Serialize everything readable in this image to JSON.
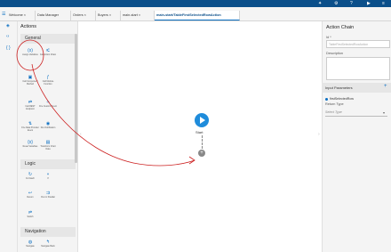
{
  "topbar": {
    "icons": [
      "settings-icon",
      "gear-icon",
      "help-icon",
      "run-icon",
      "menu-icon"
    ]
  },
  "tabs": [
    {
      "label": "Welcome ×"
    },
    {
      "label": "Data Manager"
    },
    {
      "label": "Orders ×"
    },
    {
      "label": "Buyers ×"
    },
    {
      "label": "main-start ×"
    },
    {
      "label": "main-start/TableFirstSelectedRowAction"
    }
  ],
  "left_panel": {
    "title": "Actions",
    "sections": {
      "general": "General",
      "logic": "Logic",
      "navigation": "Navigation"
    },
    "general_items": [
      {
        "label": "Assign Variables"
      },
      {
        "label": "Call Action Chain"
      },
      {
        "label": "Call Component Method"
      },
      {
        "label": "Call Module Function"
      },
      {
        "label": "Call REST Endpoint"
      },
      {
        "label": "Fire Custom Event"
      },
      {
        "label": "Fire Data Provider Event"
      },
      {
        "label": "Fire Notification"
      },
      {
        "label": "Reset Variables"
      },
      {
        "label": "Transform Chart Data"
      }
    ],
    "logic_items": [
      {
        "label": "For Each"
      },
      {
        "label": "If"
      },
      {
        "label": "Return"
      },
      {
        "label": "Run in Parallel"
      },
      {
        "label": "Switch"
      }
    ],
    "navigation_items": [
      {
        "label": "Navigate"
      },
      {
        "label": "Navigate Back"
      }
    ]
  },
  "canvas": {
    "start_label": "Start",
    "add_symbol": "+"
  },
  "right_panel": {
    "title": "Action Chain",
    "id_label": "Id *",
    "id_value": "TableFirstSelectedRowAction",
    "description_label": "Description",
    "input_params_label": "Input Parameters",
    "add_symbol": "+",
    "param_name": "firstSelectedRow",
    "return_type_label": "Return Type",
    "return_type_placeholder": "Select Type"
  },
  "colors": {
    "brand_bar": "#0b4f8a",
    "accent": "#1f8cdb",
    "annotation": "#cc1f1f"
  }
}
